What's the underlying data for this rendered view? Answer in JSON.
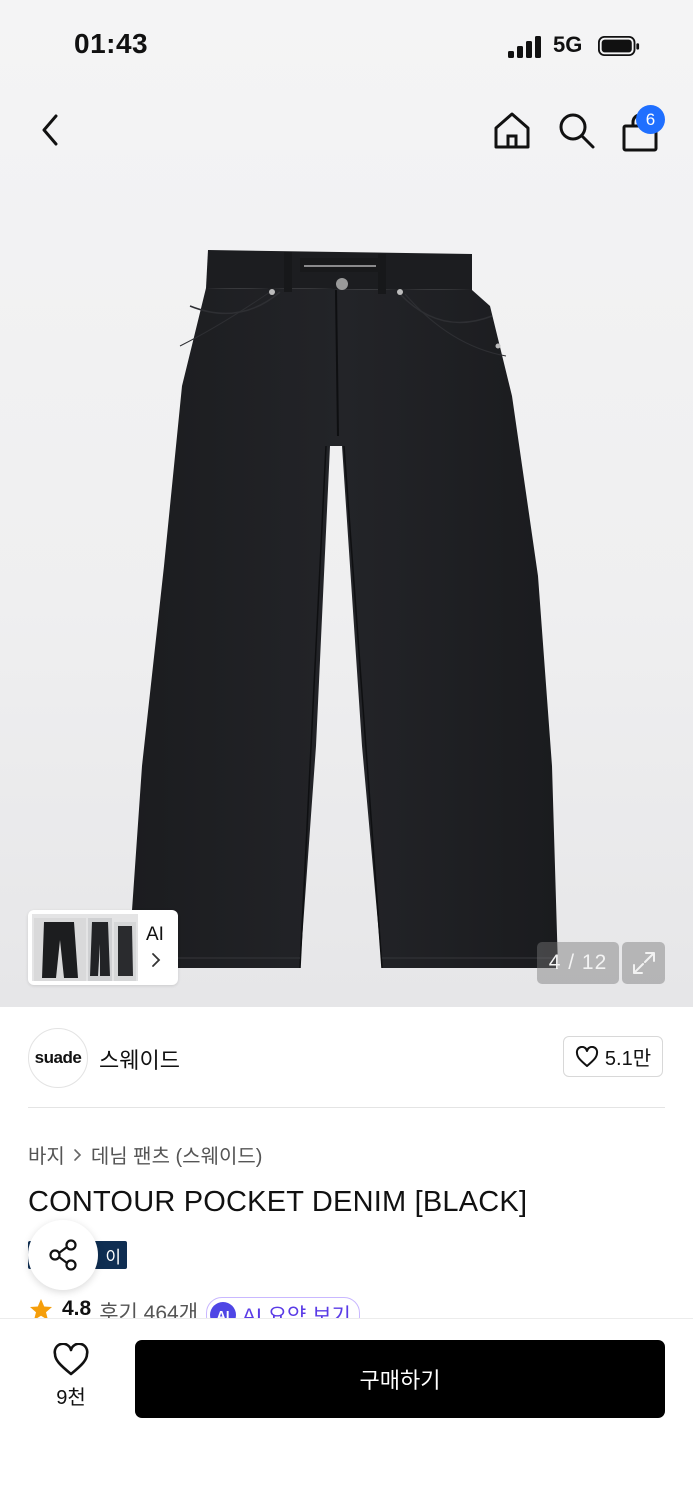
{
  "status_bar": {
    "time": "01:43",
    "network": "5G"
  },
  "header": {
    "back_icon": "chevron-left-icon",
    "home_icon": "home-icon",
    "search_icon": "search-icon",
    "cart_icon": "shopping-bag-icon",
    "cart_count": "6",
    "cart_badge_color": "#1f6fff"
  },
  "gallery": {
    "thumbnail_label": "AI",
    "counter": "4 / 12",
    "expand_icon": "expand-icon",
    "product_image": "black-denim-pants"
  },
  "brand": {
    "logo_text": "suade",
    "name": "스웨이드",
    "likes": "5.1만"
  },
  "breadcrumb": [
    "바지",
    "데님 팬츠 (스웨이드)"
  ],
  "product": {
    "title": "CONTOUR POCKET DENIM [BLACK]",
    "tag": "이",
    "tag_color": "#0f2e52",
    "rating": "4.8",
    "reviews": "후기 464개",
    "ai_chip_icon": "AI",
    "ai_summary": "AI 요약 보기"
  },
  "bottom_bar": {
    "favorite_count": "9천",
    "buy_label": "구매하기"
  }
}
